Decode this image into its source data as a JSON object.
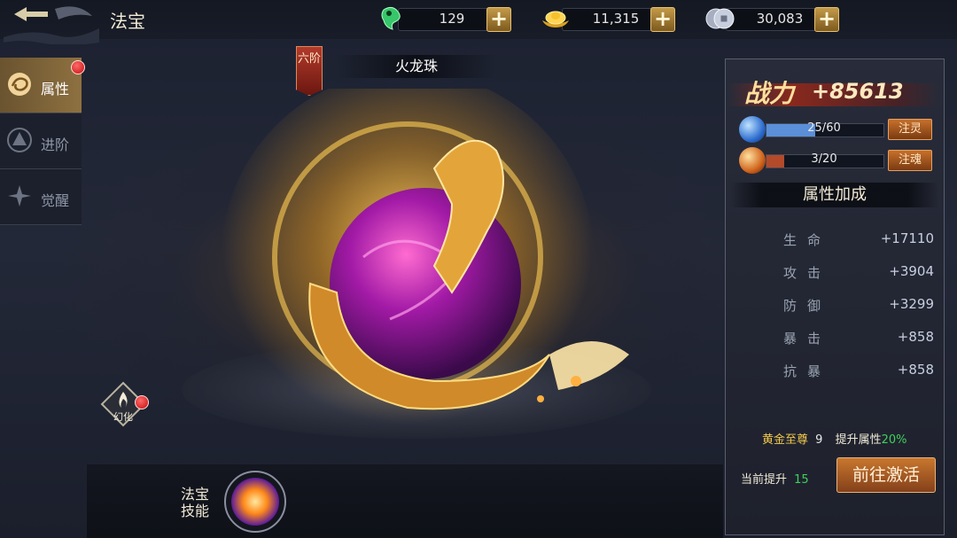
{
  "window": {
    "title": "法宝"
  },
  "currencies": [
    {
      "icon": "jade-icon",
      "value": "129"
    },
    {
      "icon": "gold-ingot-icon",
      "value": "11,315"
    },
    {
      "icon": "silver-coin-icon",
      "value": "30,083"
    }
  ],
  "tabs": [
    {
      "label": "属性",
      "icon": "attribute-icon",
      "active": true,
      "badge": true
    },
    {
      "label": "进阶",
      "icon": "advance-icon",
      "active": false,
      "badge": false
    },
    {
      "label": "觉醒",
      "icon": "awaken-icon",
      "active": false,
      "badge": false
    }
  ],
  "treasure": {
    "rank": "六阶",
    "name": "火龙珠",
    "skin_label": "幻化",
    "skill_label": "法宝技能"
  },
  "panel": {
    "power_label": "战力",
    "power_value": "+85613",
    "bars": [
      {
        "icon": "blue-orb-icon",
        "text": "25/60",
        "fraction": 0.4167,
        "button": "注灵",
        "color": "#5b8fd8"
      },
      {
        "icon": "red-orb-icon",
        "text": "3/20",
        "fraction": 0.15,
        "button": "注魂",
        "color": "#b34a2a"
      }
    ],
    "section_title": "属性加成",
    "attributes": [
      {
        "name": "生命",
        "value": "+17110"
      },
      {
        "name": "攻击",
        "value": "+3904"
      },
      {
        "name": "防御",
        "value": "+3299"
      },
      {
        "name": "暴击",
        "value": "+858"
      },
      {
        "name": "抗暴",
        "value": "+858"
      }
    ],
    "title_name": "黄金至尊",
    "title_level": "9",
    "boost_label": "提升属性",
    "boost_value": "20%",
    "current_label": "当前提升",
    "current_value": "15",
    "go_button": "前往激活"
  },
  "colors": {
    "accent": "#c8772e",
    "gold_text": "#ffdf9c",
    "green": "#3fd15a"
  }
}
